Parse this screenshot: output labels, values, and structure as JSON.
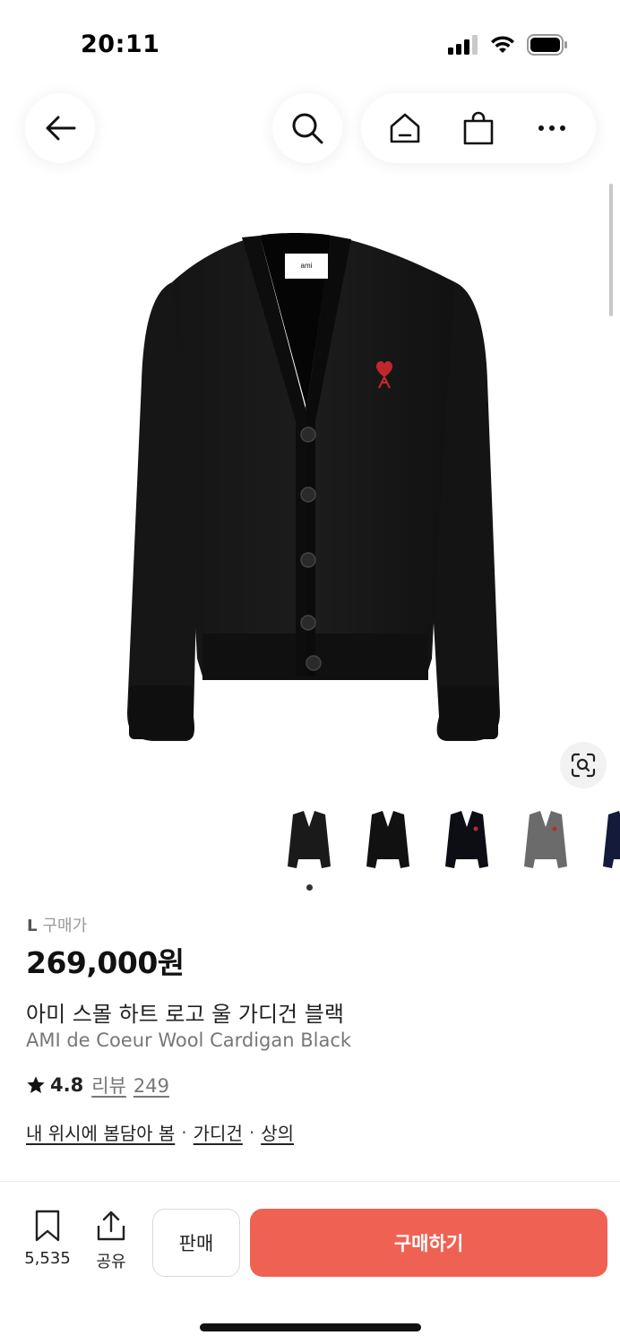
{
  "status_bar": {
    "time": "20:11"
  },
  "product": {
    "size_prefix": "L",
    "size_suffix": "구매가",
    "price": "269,000원",
    "title_ko": "아미 스몰 하트 로고 울 가디건 블랙",
    "title_en": "AMI de Coeur Wool Cardigan Black",
    "rating": "4.8",
    "review_label": "리뷰",
    "review_count": "249",
    "image_tag_label": "ami"
  },
  "breadcrumb": [
    "내 위시에 봄담아 봄",
    "가디건",
    "상의"
  ],
  "breadcrumb_sep": "·",
  "thumbnails": [
    {
      "name": "black-cardigan-1",
      "color": "#1a1a1a"
    },
    {
      "name": "black-cardigan-2",
      "color": "#111111"
    },
    {
      "name": "navy-cardigan-red-logo",
      "color": "#0d0d16"
    },
    {
      "name": "grey-cardigan",
      "color": "#6b6b6b"
    },
    {
      "name": "navy-cardigan",
      "color": "#141a3a"
    }
  ],
  "bottom_bar": {
    "wish_count": "5,535",
    "share_label": "공유",
    "sell_label": "판매",
    "buy_label": "구매하기"
  },
  "colors": {
    "accent": "#ef6253",
    "logo_red": "#c0272d"
  },
  "icons": [
    "back-arrow-icon",
    "search-icon",
    "home-icon",
    "shopping-bag-icon",
    "more-icon",
    "lens-icon",
    "bookmark-icon",
    "share-icon",
    "star-icon"
  ]
}
